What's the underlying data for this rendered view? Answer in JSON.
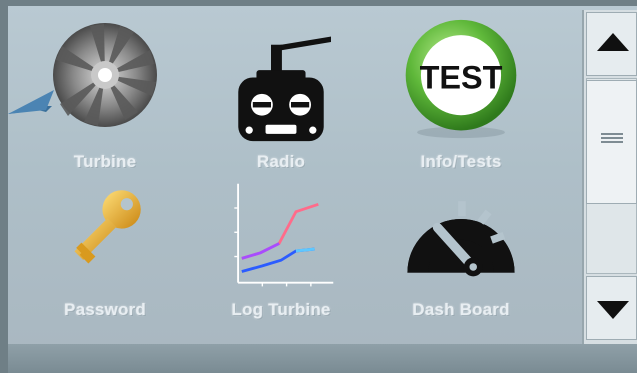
{
  "tiles": {
    "turbine": {
      "label": "Turbine",
      "icon": "turbine-icon"
    },
    "radio": {
      "label": "Radio",
      "icon": "radio-transmitter-icon"
    },
    "info": {
      "label": "Info/Tests",
      "icon": "test-badge-icon",
      "badge_text": "TEST"
    },
    "password": {
      "label": "Password",
      "icon": "key-icon"
    },
    "log": {
      "label": "Log Turbine",
      "icon": "line-chart-icon"
    },
    "dash": {
      "label": "Dash Board",
      "icon": "gauge-icon"
    }
  },
  "scrollbar": {
    "up_icon": "triangle-up-icon",
    "down_icon": "triangle-down-icon",
    "thumb_icon": "grip-lines-icon"
  },
  "colors": {
    "screen_bg": "#b4c4cd",
    "label": "#e8eef2",
    "test_green": "#5fb83a",
    "key_gold": "#e6a51c",
    "pointer": "#3a6f9a"
  }
}
